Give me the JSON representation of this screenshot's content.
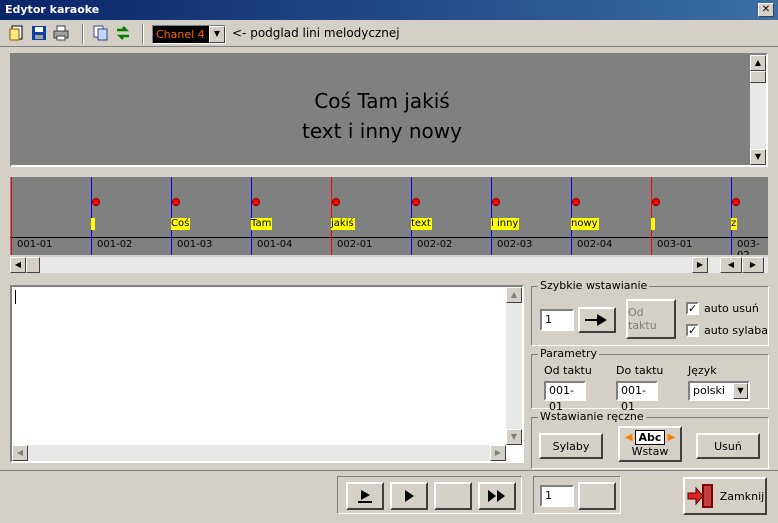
{
  "window": {
    "title": "Edytor karaoke",
    "close": "✕"
  },
  "toolbar": {
    "channel": "Chanel 4",
    "hint": "<- podglad lini melodycznej"
  },
  "preview": {
    "line1": "Coś Tam jakiś",
    "line2": "text i inny nowy"
  },
  "timeline": {
    "ticks": [
      "001-01",
      "001-02",
      "001-03",
      "001-04",
      "002-01",
      "002-02",
      "002-03",
      "002-04",
      "003-01",
      "003-02"
    ],
    "markers": [
      {
        "pos": 1,
        "color": "#0000ff",
        "syl": ""
      },
      {
        "pos": 2,
        "color": "#0000ff",
        "syl": "Coś"
      },
      {
        "pos": 3,
        "color": "#0000ff",
        "syl": "Tam"
      },
      {
        "pos": 4,
        "color": "#ff0000",
        "syl": "jakiś"
      },
      {
        "pos": 5,
        "color": "#0000ff",
        "syl": "text"
      },
      {
        "pos": 6,
        "color": "#0000ff",
        "syl": "i inny"
      },
      {
        "pos": 7,
        "color": "#0000ff",
        "syl": "nowy"
      },
      {
        "pos": 8,
        "color": "#ff0000",
        "syl": ""
      },
      {
        "pos": 9,
        "color": "#0000ff",
        "syl": "z"
      }
    ]
  },
  "quick_insert": {
    "title": "Szybkie wstawianie",
    "value": "1",
    "od_taktu": "Od taktu",
    "auto_remove": "auto usuń",
    "auto_syllable": "auto sylaba"
  },
  "params": {
    "title": "Parametry",
    "from_label": "Od taktu",
    "to_label": "Do taktu",
    "lang_label": "Język",
    "from": "001-01",
    "to": "001-01",
    "lang": "polski"
  },
  "manual": {
    "title": "Wstawianie ręczne",
    "syllables": "Sylaby",
    "abc": "Abc",
    "insert": "Wstaw",
    "delete": "Usuń"
  },
  "bottom": {
    "counter": "1",
    "close": "Zamknij"
  }
}
